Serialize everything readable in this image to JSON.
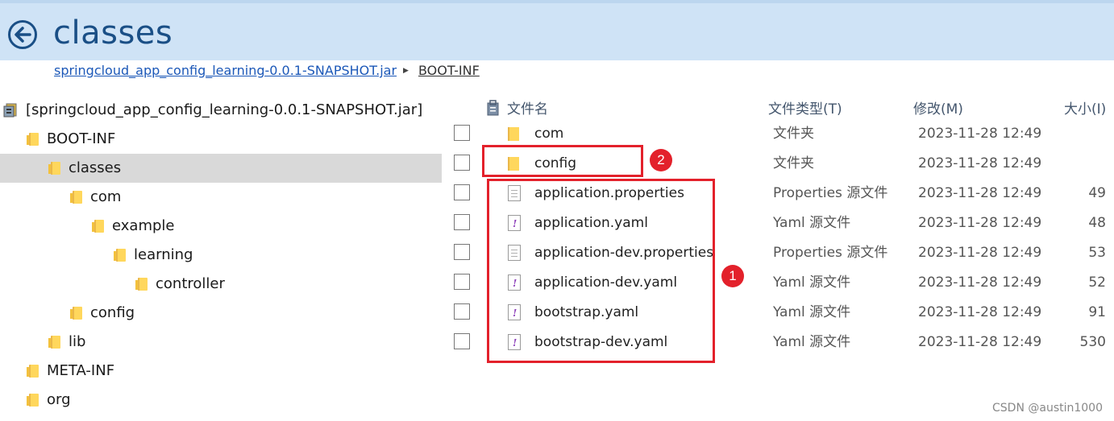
{
  "header": {
    "title": "classes"
  },
  "breadcrumb": {
    "items": [
      "springcloud_app_config_learning-0.0.1-SNAPSHOT.jar",
      "BOOT-INF"
    ]
  },
  "tree": [
    {
      "label": "[springcloud_app_config_learning-0.0.1-SNAPSHOT.jar]",
      "icon": "jar-icon",
      "depth": 0
    },
    {
      "label": "BOOT-INF",
      "icon": "folder-icon",
      "depth": 1
    },
    {
      "label": "classes",
      "icon": "folder-icon",
      "depth": 2,
      "selected": true
    },
    {
      "label": "com",
      "icon": "folder-icon",
      "depth": 3
    },
    {
      "label": "example",
      "icon": "folder-icon",
      "depth": 4
    },
    {
      "label": "learning",
      "icon": "folder-icon",
      "depth": 5
    },
    {
      "label": "controller",
      "icon": "folder-icon",
      "depth": 6
    },
    {
      "label": "config",
      "icon": "folder-icon",
      "depth": 3
    },
    {
      "label": "lib",
      "icon": "folder-icon",
      "depth": 2
    },
    {
      "label": "META-INF",
      "icon": "folder-icon",
      "depth": 1
    },
    {
      "label": "org",
      "icon": "folder-icon",
      "depth": 1
    }
  ],
  "columns": {
    "name": "文件名",
    "type": "文件类型(T)",
    "modified": "修改(M)",
    "size": "大小(I)"
  },
  "files": [
    {
      "name": "com",
      "type": "文件夹",
      "modified": "2023-11-28 12:49",
      "size": "",
      "icon": "folder-icon"
    },
    {
      "name": "config",
      "type": "文件夹",
      "modified": "2023-11-28 12:49",
      "size": "",
      "icon": "folder-icon"
    },
    {
      "name": "application.properties",
      "type": "Properties 源文件",
      "modified": "2023-11-28 12:49",
      "size": "49",
      "icon": "properties-file-icon"
    },
    {
      "name": "application.yaml",
      "type": "Yaml 源文件",
      "modified": "2023-11-28 12:49",
      "size": "48",
      "icon": "yaml-file-icon"
    },
    {
      "name": "application-dev.properties",
      "type": "Properties 源文件",
      "modified": "2023-11-28 12:49",
      "size": "53",
      "icon": "properties-file-icon"
    },
    {
      "name": "application-dev.yaml",
      "type": "Yaml 源文件",
      "modified": "2023-11-28 12:49",
      "size": "52",
      "icon": "yaml-file-icon"
    },
    {
      "name": "bootstrap.yaml",
      "type": "Yaml 源文件",
      "modified": "2023-11-28 12:49",
      "size": "91",
      "icon": "yaml-file-icon"
    },
    {
      "name": "bootstrap-dev.yaml",
      "type": "Yaml 源文件",
      "modified": "2023-11-28 12:49",
      "size": "530",
      "icon": "yaml-file-icon"
    }
  ],
  "annotations": {
    "badge_1": "1",
    "badge_2": "2"
  },
  "colors": {
    "accent": "#1a4f86",
    "header_bg": "#cfe3f6",
    "highlight": "#e3212b"
  },
  "watermark": "CSDN @austin1000"
}
